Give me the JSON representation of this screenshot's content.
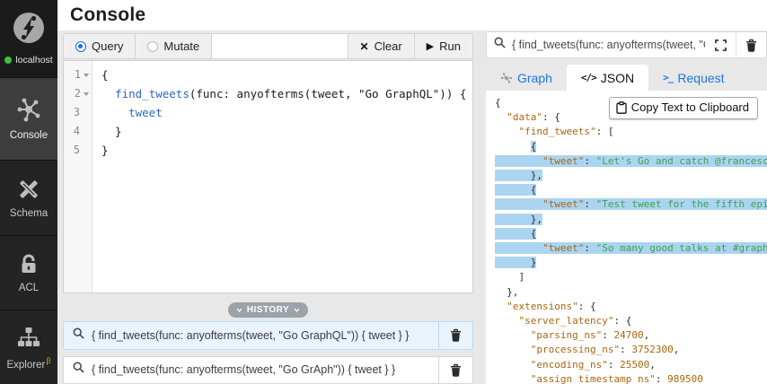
{
  "sidebar": {
    "connection": {
      "label": "localhost",
      "status": "connected",
      "status_color": "#3ec23e"
    },
    "items": [
      {
        "label": "Console",
        "icon": "graph-nodes-icon",
        "active": true
      },
      {
        "label": "Schema",
        "icon": "schema-tools-icon",
        "active": false
      },
      {
        "label": "ACL",
        "icon": "lock-icon",
        "active": false
      },
      {
        "label": "Explorer",
        "icon": "sitemap-icon",
        "badge": "β",
        "active": false
      }
    ]
  },
  "header": {
    "title": "Console"
  },
  "toolbar": {
    "query_label": "Query",
    "mutate_label": "Mutate",
    "clear_label": "Clear",
    "run_label": "Run",
    "selected_mode": "Query"
  },
  "editor": {
    "lines": [
      {
        "num": "1",
        "fold": true,
        "segments": [
          {
            "x": "{"
          }
        ]
      },
      {
        "num": "2",
        "fold": true,
        "segments": [
          {
            "x": "  "
          },
          {
            "x": "find_tweets",
            "t": "fn"
          },
          {
            "x": "(func: anyofterms(tweet, \"Go GraphQL\")) {"
          }
        ]
      },
      {
        "num": "3",
        "fold": false,
        "segments": [
          {
            "x": "    "
          },
          {
            "x": "tweet",
            "t": "fn"
          }
        ]
      },
      {
        "num": "4",
        "fold": false,
        "segments": [
          {
            "x": "  }"
          }
        ]
      },
      {
        "num": "5",
        "fold": false,
        "segments": [
          {
            "x": "}"
          }
        ]
      }
    ]
  },
  "history": {
    "toggle_label": "HISTORY",
    "items": [
      {
        "query": "{ find_tweets(func: anyofterms(tweet, \"Go GraphQL\")) { tweet } }",
        "active": true
      },
      {
        "query": "{ find_tweets(func: anyofterms(tweet, \"Go GrAph\")) { tweet } }",
        "active": false
      }
    ]
  },
  "results": {
    "search_value": "{ find_tweets(func: anyofterms(tweet, \"Go ...",
    "tabs": [
      {
        "label": "Graph",
        "icon": "graph-tab-icon",
        "active": false
      },
      {
        "label": "JSON",
        "icon": "code-tag-icon",
        "active": true
      },
      {
        "label": "Request",
        "icon": "terminal-prompt-icon",
        "active": false
      }
    ],
    "copy_button_label": "Copy Text to Clipboard",
    "json": {
      "lines": [
        {
          "segments": [
            {
              "x": "{"
            }
          ]
        },
        {
          "segments": [
            {
              "x": "  "
            },
            {
              "x": "\"data\"",
              "t": "k"
            },
            {
              "x": ": {"
            }
          ]
        },
        {
          "segments": [
            {
              "x": "    "
            },
            {
              "x": "\"find_tweets\"",
              "t": "k"
            },
            {
              "x": ": ["
            }
          ]
        },
        {
          "segments": [
            {
              "x": "      "
            },
            {
              "x": "{",
              "hl": true
            }
          ]
        },
        {
          "segments": [
            {
              "x": "        ",
              "hl": true
            },
            {
              "x": "\"tweet\"",
              "t": "k",
              "hl": true
            },
            {
              "x": ": ",
              "hl": true
            },
            {
              "x": "\"Let's Go and catch @francesc",
              "t": "s",
              "hl": true
            }
          ]
        },
        {
          "segments": [
            {
              "x": "      },",
              "hl": true
            }
          ]
        },
        {
          "segments": [
            {
              "x": "      {",
              "hl": true
            }
          ]
        },
        {
          "segments": [
            {
              "x": "        ",
              "hl": true
            },
            {
              "x": "\"tweet\"",
              "t": "k",
              "hl": true
            },
            {
              "x": ": ",
              "hl": true
            },
            {
              "x": "\"Test tweet for the fifth epis",
              "t": "s",
              "hl": true
            }
          ]
        },
        {
          "segments": [
            {
              "x": "      },",
              "hl": true
            }
          ]
        },
        {
          "segments": [
            {
              "x": "      {",
              "hl": true
            }
          ]
        },
        {
          "segments": [
            {
              "x": "        ",
              "hl": true
            },
            {
              "x": "\"tweet\"",
              "t": "k",
              "hl": true
            },
            {
              "x": ": ",
              "hl": true
            },
            {
              "x": "\"So many good talks at #grapho",
              "t": "s",
              "hl": true
            }
          ]
        },
        {
          "segments": [
            {
              "x": "      }",
              "hl": true
            }
          ]
        },
        {
          "segments": [
            {
              "x": "    ]"
            }
          ]
        },
        {
          "segments": [
            {
              "x": "  },"
            }
          ]
        },
        {
          "segments": [
            {
              "x": "  "
            },
            {
              "x": "\"extensions\"",
              "t": "k"
            },
            {
              "x": ": {"
            }
          ]
        },
        {
          "segments": [
            {
              "x": "    "
            },
            {
              "x": "\"server_latency\"",
              "t": "k"
            },
            {
              "x": ": {"
            }
          ]
        },
        {
          "segments": [
            {
              "x": "      "
            },
            {
              "x": "\"parsing_ns\"",
              "t": "k"
            },
            {
              "x": ": "
            },
            {
              "x": "24700",
              "t": "n"
            },
            {
              "x": ","
            }
          ]
        },
        {
          "segments": [
            {
              "x": "      "
            },
            {
              "x": "\"processing_ns\"",
              "t": "k"
            },
            {
              "x": ": "
            },
            {
              "x": "3752300",
              "t": "n"
            },
            {
              "x": ","
            }
          ]
        },
        {
          "segments": [
            {
              "x": "      "
            },
            {
              "x": "\"encoding_ns\"",
              "t": "k"
            },
            {
              "x": ": "
            },
            {
              "x": "25500",
              "t": "n"
            },
            {
              "x": ","
            }
          ]
        },
        {
          "segments": [
            {
              "x": "      "
            },
            {
              "x": "\"assign_timestamp_ns\"",
              "t": "k"
            },
            {
              "x": ": "
            },
            {
              "x": "989500",
              "t": "n"
            }
          ]
        }
      ]
    }
  },
  "colors": {
    "accent_blue": "#1d78e0",
    "selection_blue": "#abd4f1",
    "json_key": "#a9660e",
    "json_string": "#3da24d",
    "status_green": "#3ec23e",
    "sidebar_bg": "#1b1b1b",
    "sidebar_active_bg": "#3d3d3d"
  }
}
